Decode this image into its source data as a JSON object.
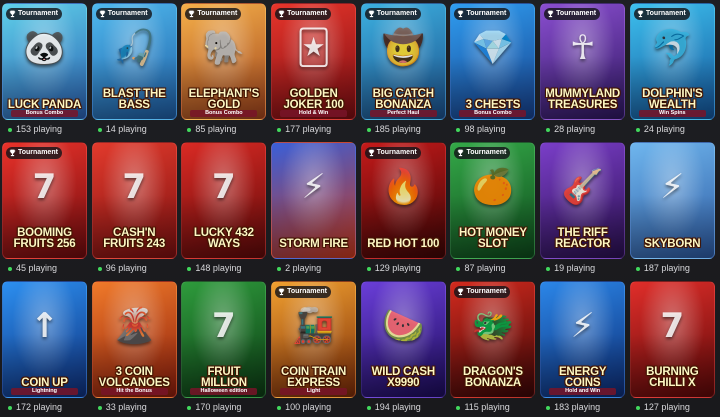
{
  "colors": {
    "background": "#1b1c1f",
    "online_dot": "#41d95d",
    "count_text": "#d7d7da"
  },
  "games": [
    {
      "title": "Luck Panda",
      "subtitle": "Bonus Combo",
      "badge": "Tournament",
      "players": "153 playing",
      "bg": [
        "#5fd0ea",
        "#2a5fb0"
      ],
      "art": "🐼",
      "icon": "panda-icon"
    },
    {
      "title": "Blast the Bass",
      "subtitle": "",
      "badge": "Tournament",
      "players": "14 playing",
      "bg": [
        "#4fb9ee",
        "#1f5da4"
      ],
      "art": "🎣",
      "icon": "fishing-icon"
    },
    {
      "title": "Elephant's Gold",
      "subtitle": "Bonus Combo",
      "badge": "Tournament",
      "players": "85 playing",
      "bg": [
        "#f5b04a",
        "#a0431c"
      ],
      "art": "🐘",
      "icon": "elephant-icon"
    },
    {
      "title": "Golden Joker 100",
      "subtitle": "Hold & Win",
      "badge": "Tournament",
      "players": "177 playing",
      "bg": [
        "#e7352b",
        "#7a0d12"
      ],
      "art": "🃏",
      "icon": "joker-icon"
    },
    {
      "title": "Big Catch Bonanza",
      "subtitle": "Perfect Haul",
      "badge": "Tournament",
      "players": "185 playing",
      "bg": [
        "#3cb0e0",
        "#1c4f8a"
      ],
      "art": "🤠",
      "icon": "fisherman-icon"
    },
    {
      "title": "3 Chests",
      "subtitle": "Bonus Combo",
      "badge": "Tournament",
      "players": "98 playing",
      "bg": [
        "#2f9df0",
        "#17408c"
      ],
      "art": "💎",
      "icon": "chest-icon"
    },
    {
      "title": "Mummyland Treasures",
      "subtitle": "",
      "badge": "Tournament",
      "players": "28 playing",
      "bg": [
        "#8a4ed0",
        "#2e1860"
      ],
      "art": "☥",
      "icon": "mummy-icon"
    },
    {
      "title": "Dolphin's Wealth",
      "subtitle": "Win Spins",
      "badge": "Tournament",
      "players": "24 playing",
      "bg": [
        "#3dc0ee",
        "#14549a"
      ],
      "art": "🐬",
      "icon": "dolphin-icon"
    },
    {
      "title": "Booming Fruits 256",
      "subtitle": "",
      "badge": "Tournament",
      "players": "45 playing",
      "bg": [
        "#e9322a",
        "#6e0b0e"
      ],
      "art": "7",
      "icon": "seven-icon"
    },
    {
      "title": "Cash'n Fruits 243",
      "subtitle": "",
      "badge": "",
      "players": "96 playing",
      "bg": [
        "#e23a2c",
        "#7b1010"
      ],
      "art": "7",
      "icon": "seven-icon"
    },
    {
      "title": "Lucky 432 Ways",
      "subtitle": "",
      "badge": "",
      "players": "148 playing",
      "bg": [
        "#d92a24",
        "#5e0909"
      ],
      "art": "7",
      "icon": "seven-icon"
    },
    {
      "title": "Storm Fire",
      "subtitle": "",
      "badge": "",
      "players": "2 playing",
      "bg": [
        "#3a5fd8",
        "#c8381c"
      ],
      "art": "⚡",
      "icon": "lightning-icon"
    },
    {
      "title": "Red Hot 100",
      "subtitle": "",
      "badge": "Tournament",
      "players": "129 playing",
      "bg": [
        "#c41a1a",
        "#3c0505"
      ],
      "art": "🔥",
      "icon": "flame-icon"
    },
    {
      "title": "Hot Money Slot",
      "subtitle": "",
      "badge": "Tournament",
      "players": "87 playing",
      "bg": [
        "#34a848",
        "#0e4a1c"
      ],
      "art": "🍊",
      "icon": "orange-icon"
    },
    {
      "title": "The Riff Reactor",
      "subtitle": "",
      "badge": "",
      "players": "19 playing",
      "bg": [
        "#7a3ec8",
        "#2a1050"
      ],
      "art": "🎸",
      "icon": "guitar-icon"
    },
    {
      "title": "Skyborn",
      "subtitle": "",
      "badge": "",
      "players": "187 playing",
      "bg": [
        "#6fb6ee",
        "#2d5aa2"
      ],
      "art": "⚡",
      "icon": "zeus-icon"
    },
    {
      "title": "Coin Up",
      "subtitle": "Lightning",
      "badge": "",
      "players": "172 playing",
      "bg": [
        "#2c8ff0",
        "#0f2f7a"
      ],
      "art": "↑",
      "icon": "arrow-up-icon"
    },
    {
      "title": "3 Coin Volcanoes",
      "subtitle": "Hit the Bonus",
      "badge": "",
      "players": "33 playing",
      "bg": [
        "#f07a2a",
        "#8a1c0c"
      ],
      "art": "🌋",
      "icon": "volcano-icon"
    },
    {
      "title": "Fruit Million",
      "subtitle": "Halloween edition",
      "badge": "",
      "players": "170 playing",
      "bg": [
        "#2e9b3c",
        "#0c3a14"
      ],
      "art": "7",
      "icon": "seven-icon"
    },
    {
      "title": "Coin Train Express",
      "subtitle": "Light",
      "badge": "Tournament",
      "players": "100 playing",
      "bg": [
        "#f0a030",
        "#7a2a08"
      ],
      "art": "🚂",
      "icon": "train-icon"
    },
    {
      "title": "Wild Cash x9990",
      "subtitle": "",
      "badge": "",
      "players": "194 playing",
      "bg": [
        "#6a3ed8",
        "#1c0c5a"
      ],
      "art": "🍉",
      "icon": "watermelon-icon"
    },
    {
      "title": "Dragon's Bonanza",
      "subtitle": "",
      "badge": "Tournament",
      "players": "115 playing",
      "bg": [
        "#d22a1e",
        "#3a0606"
      ],
      "art": "🐲",
      "icon": "dragon-icon"
    },
    {
      "title": "Energy Coins",
      "subtitle": "Hold and Win",
      "badge": "",
      "players": "183 playing",
      "bg": [
        "#2b86e8",
        "#0d2c74"
      ],
      "art": "⚡",
      "icon": "lightning-icon"
    },
    {
      "title": "Burning Chilli X",
      "subtitle": "",
      "badge": "",
      "players": "127 playing",
      "bg": [
        "#e02e2a",
        "#5c0808"
      ],
      "art": "7",
      "icon": "seven-icon"
    }
  ]
}
